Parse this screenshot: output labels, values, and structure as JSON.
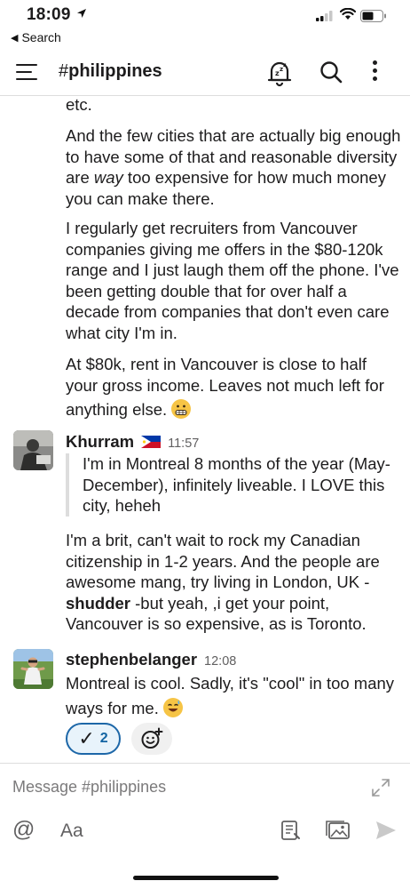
{
  "status_bar": {
    "time": "18:09",
    "back_label": "Search"
  },
  "header": {
    "hash": "#",
    "channel_name": "philippines"
  },
  "messages": {
    "prev_tail": "etc.",
    "prev_p1": "And the few cities that are actually big enough to have some of that and reasonable diversity are ",
    "prev_p1_em": "way",
    "prev_p1_end": " too expensive for how much money you can make there.",
    "prev_p2": "I regularly get recruiters from Vancouver companies giving me offers in the $80-120k range and I just laugh them off the phone. I've been getting double that for over half a decade from companies that don't even care what city I'm in.",
    "prev_p3": "At $80k, rent in Vancouver is close to half your gross income. Leaves not much left for anything else.",
    "khurram": {
      "author": "Khurram",
      "time": "11:57",
      "quote": "I'm in Montreal 8 months of the year (May-December), infinitely liveable. I LOVE this city, heheh",
      "text_start": "I'm a brit, can't wait to rock my Canadian citizenship in 1-2 years. And the people are awesome mang, try living in London, UK - ",
      "text_bold": "shudder",
      "text_end": " -but yeah, ,i get your point, Vancouver is so expensive, as is Toronto."
    },
    "stephen": {
      "author": "stephenbelanger",
      "time": "12:08",
      "text": "Montreal is cool. Sadly, it's \"cool\" in too many ways for me."
    }
  },
  "reactions": {
    "check_mark": "✓",
    "check_count": "2"
  },
  "composer": {
    "placeholder": "Message #philippines",
    "at_label": "@",
    "format_label": "Aa"
  }
}
